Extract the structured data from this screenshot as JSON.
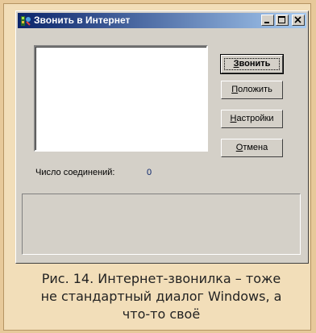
{
  "window": {
    "title": "Звонить в Интернет",
    "icons": {
      "app": "phone-globe-icon",
      "minimize": "minimize-icon",
      "maximize": "maximize-icon",
      "close": "close-icon"
    }
  },
  "buttons": {
    "call": {
      "accel": "З",
      "rest": "вонить"
    },
    "hangup": {
      "accel": "П",
      "rest": "оложить"
    },
    "settings": {
      "accel": "Н",
      "rest": "астройки"
    },
    "cancel": {
      "accel": "О",
      "rest": "тмена"
    }
  },
  "connections": {
    "label": "Число соединений:",
    "value": "0"
  },
  "caption": {
    "line1": "Рис. 14. Интернет-звонилка – тоже",
    "line2": "не стандартный диалог Windows, а",
    "line3": "что-то своё"
  },
  "colors": {
    "titlebar_start": "#0a246a",
    "titlebar_end": "#a6caf0",
    "dialog_face": "#d4d0c8",
    "page_bg": "#e7c99a"
  }
}
